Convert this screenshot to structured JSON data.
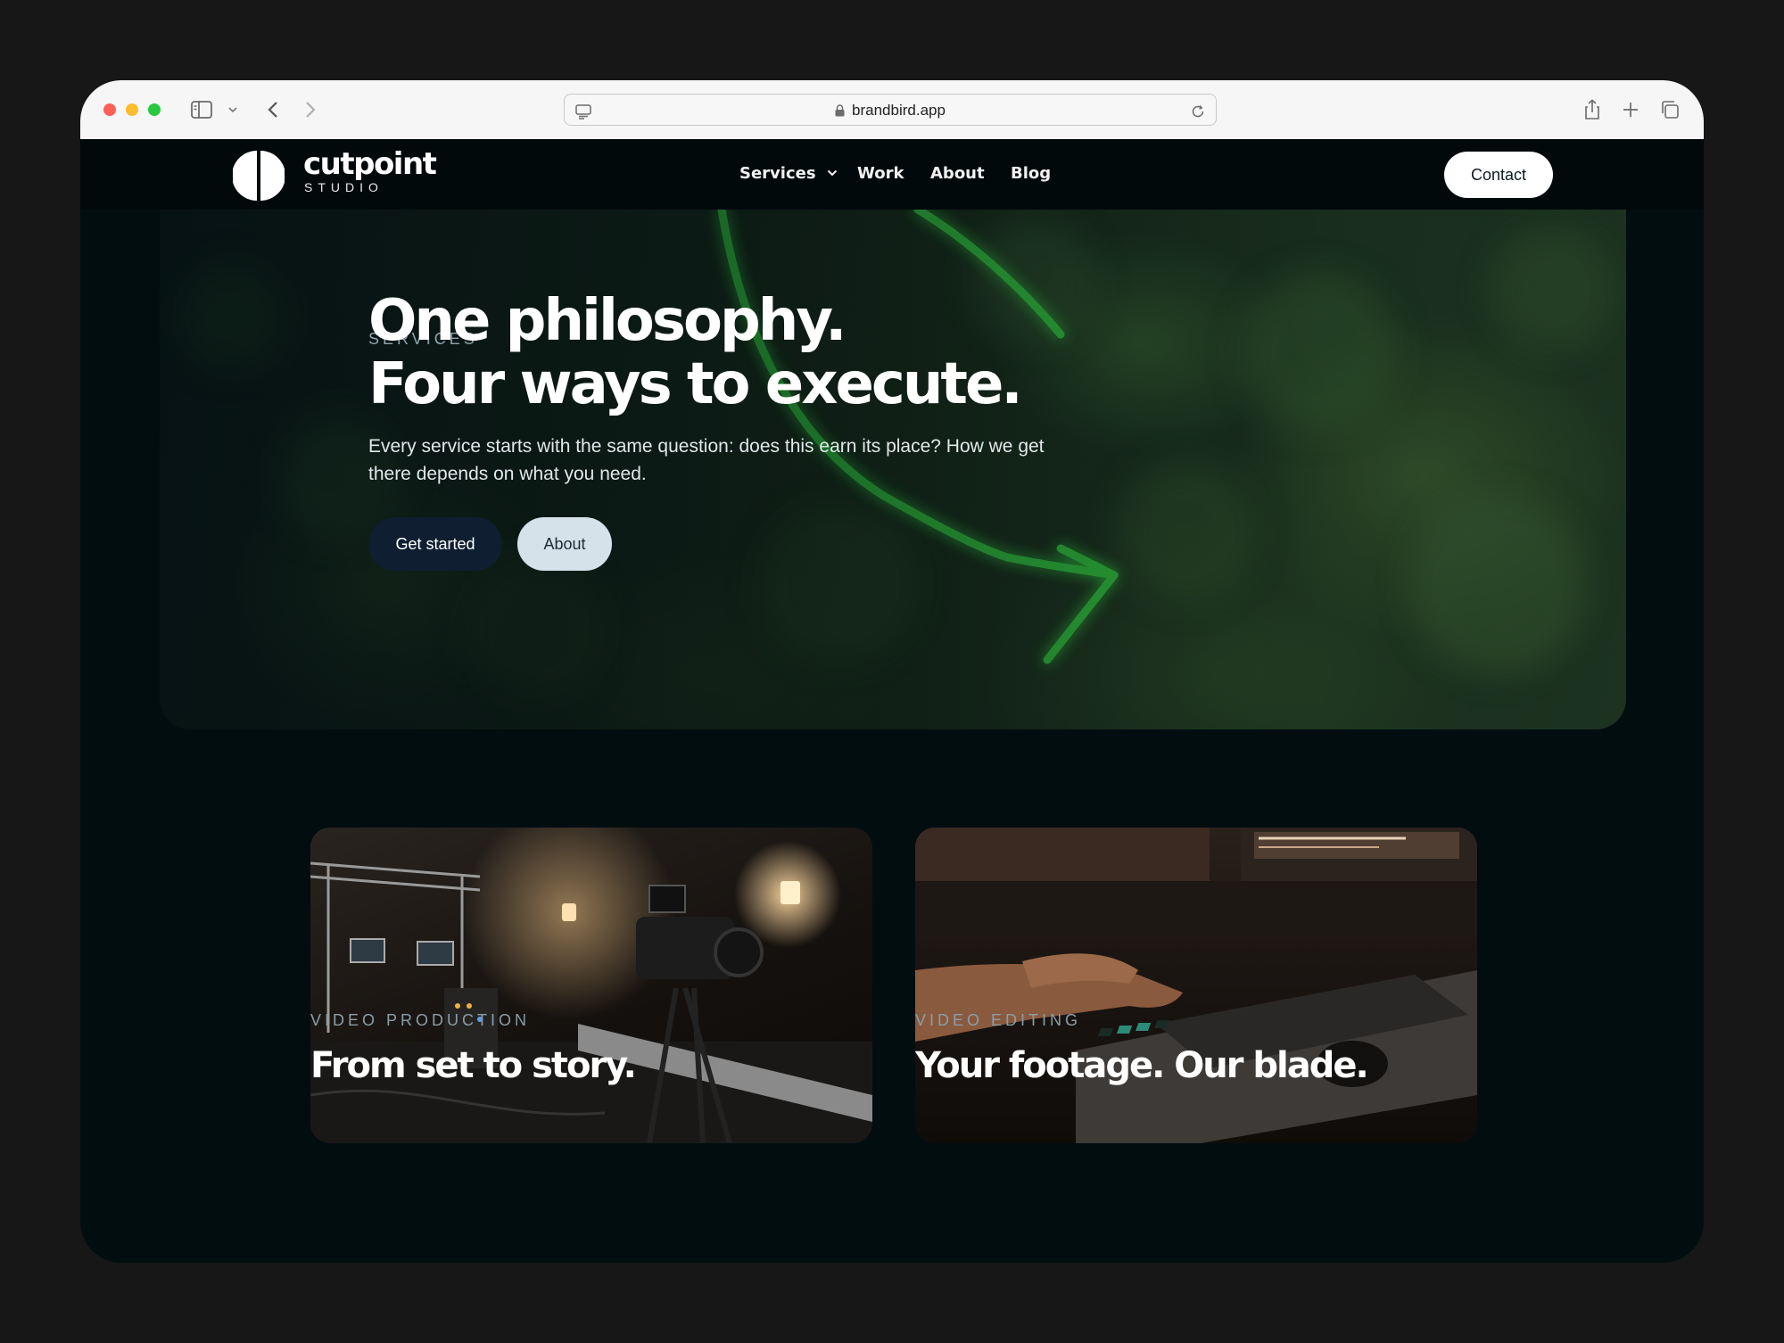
{
  "browser": {
    "url": "brandbird.app"
  },
  "site": {
    "logo": {
      "name": "cutpoint",
      "tagline": "STUDIO"
    },
    "nav": {
      "items": [
        "Services",
        "Work",
        "About",
        "Blog"
      ],
      "contact_label": "Contact"
    }
  },
  "hero": {
    "eyebrow": "SERVICES",
    "title_line1": "One philosophy.",
    "title_line2": "Four ways to execute.",
    "subtitle": "Every service starts with the same question: does this earn its place? How we get there depends on what you need.",
    "primary_cta": "Get started",
    "secondary_cta": "About"
  },
  "services": [
    {
      "label": "VIDEO PRODUCTION",
      "title": "From set to story."
    },
    {
      "label": "VIDEO EDITING",
      "title": "Your footage. Our blade."
    }
  ],
  "colors": {
    "page_background": "#171717",
    "site_background": "#020d10",
    "accent_green": "#2fb83a",
    "primary_button": "#0f1f31",
    "secondary_button": "#d6e2ea"
  }
}
